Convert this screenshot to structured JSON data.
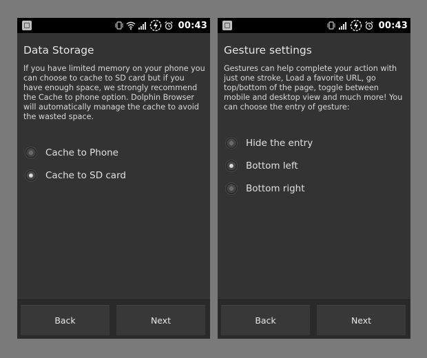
{
  "status_bar": {
    "time": "00:43"
  },
  "screens": [
    {
      "title": "Data Storage",
      "description": "If you have limited memory on your phone you can choose to cache to SD card but if you have enough space, we strongly recommend the Cache to phone option. Dolphin Browser will automatically manage the cache to avoid the wasted space.",
      "options": [
        {
          "label": "Cache to Phone",
          "selected": false
        },
        {
          "label": "Cache to SD card",
          "selected": true
        }
      ],
      "back_label": "Back",
      "next_label": "Next"
    },
    {
      "title": "Gesture settings",
      "description": "Gestures can help complete your action with just one stroke, Load a favorite URL, go top/bottom of the page, toggle between mobile and desktop view and much more! You can choose the entry of gesture:",
      "options": [
        {
          "label": "Hide the entry",
          "selected": false
        },
        {
          "label": "Bottom left",
          "selected": true
        },
        {
          "label": "Bottom right",
          "selected": false
        }
      ],
      "back_label": "Back",
      "next_label": "Next"
    }
  ]
}
